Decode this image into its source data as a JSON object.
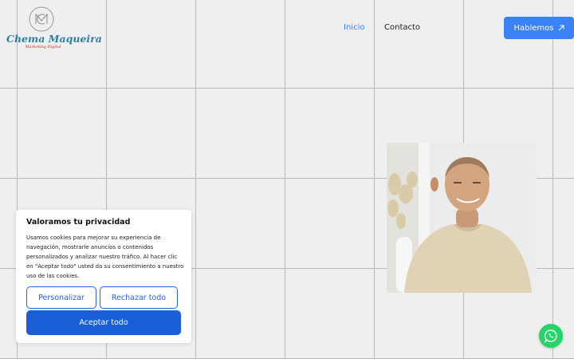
{
  "brand": {
    "name": "Chema Maqueira",
    "tagline": "Marketing Digital"
  },
  "nav": {
    "items": [
      {
        "label": "Inicio",
        "active": true
      },
      {
        "label": "Contacto",
        "active": false
      }
    ]
  },
  "cta": {
    "label": "Hablemos",
    "icon": "arrow-up-right-icon"
  },
  "cookie_banner": {
    "title": "Valoramos tu privacidad",
    "text": "Usamos cookies para mejorar su experiencia de navegación, mostrarle anuncios o contenidos personalizados y analizar nuestro tráfico. Al hacer clic en \"Aceptar todo\" usted da su consentimiento a nuestro uso de las cookies.",
    "customize_label": "Personalizar",
    "reject_label": "Rechazar todo",
    "accept_label": "Aceptar todo"
  },
  "floating": {
    "icon": "whatsapp-icon"
  },
  "colors": {
    "accent": "#3b82f6",
    "accept": "#1a5fd6",
    "whatsapp": "#25d366",
    "brand": "#2d7fa3"
  }
}
